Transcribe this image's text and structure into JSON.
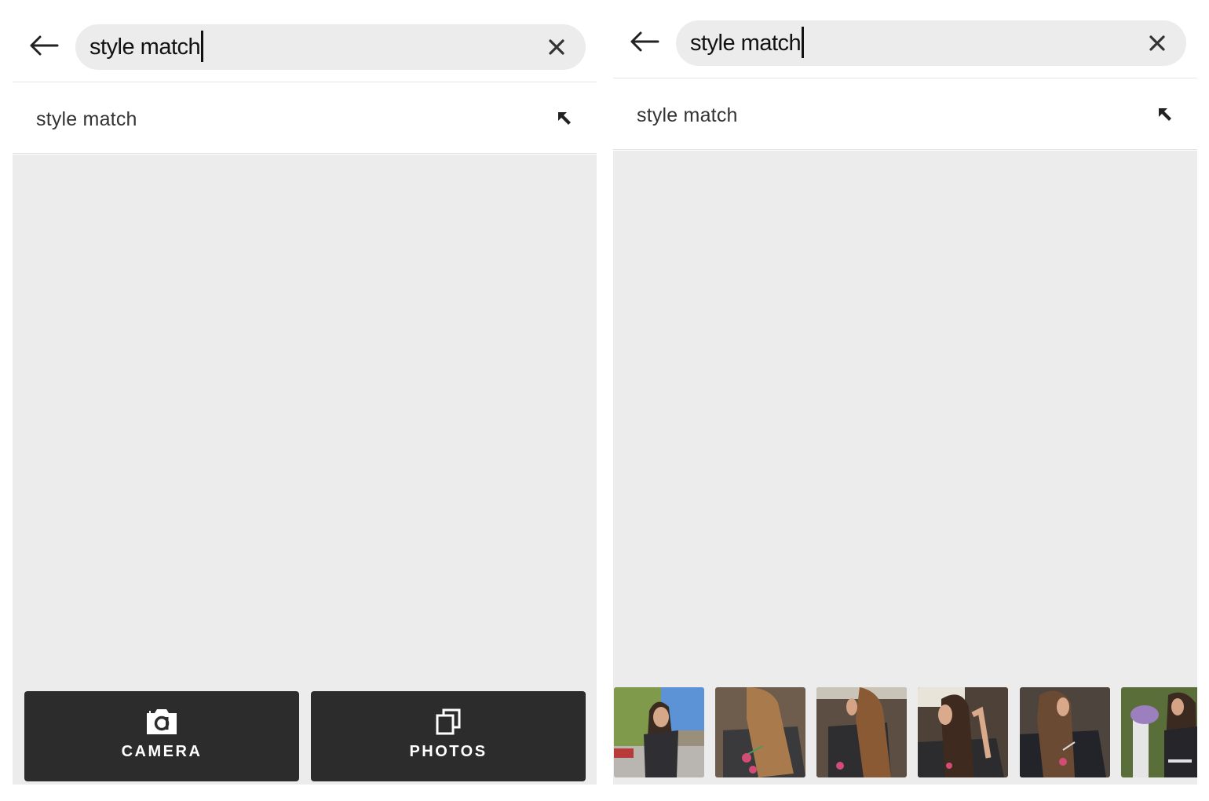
{
  "left_screen": {
    "search": {
      "value": "style match",
      "placeholder": ""
    },
    "suggestions": [
      {
        "label": "style match"
      }
    ],
    "actions": [
      {
        "label": "CAMERA",
        "icon": "camera-icon"
      },
      {
        "label": "PHOTOS",
        "icon": "photos-icon"
      }
    ]
  },
  "right_screen": {
    "search": {
      "value": "style match",
      "placeholder": ""
    },
    "suggestions": [
      {
        "label": "style match"
      }
    ],
    "recent_photos": [
      {
        "description": "woman with long hair in black t-shirt, street with trees and blue sky"
      },
      {
        "description": "long light brown hair, black floral t-shirt"
      },
      {
        "description": "long hair profile, wooden fence background"
      },
      {
        "description": "woman touching hair, wooden fence background"
      },
      {
        "description": "long straight hair, black floral t-shirt, fence"
      },
      {
        "description": "woman beside flower pot, graphic t-shirt"
      }
    ]
  },
  "icons": {
    "back": "arrow-left-icon",
    "clear": "close-icon",
    "fill_suggestion": "arrow-up-left-icon"
  },
  "colors": {
    "pill_bg": "#ececec",
    "panel_bg": "#ececec",
    "button_bg": "#2c2c2c",
    "text": "#111111"
  }
}
